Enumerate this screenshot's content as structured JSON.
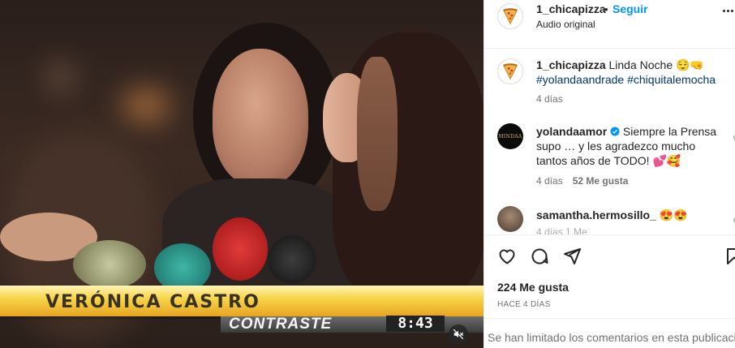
{
  "video": {
    "lower_third_name": "VERÓNICA CASTRO",
    "ticker_label": "CONTRASTE",
    "ticker_time": "8:43",
    "mute_icon": "speaker-muted-icon"
  },
  "header": {
    "username": "1_chicapizza",
    "separator": "•",
    "follow_label": "Seguir",
    "audio_label": "Audio original",
    "more_icon": "more-horizontal-icon"
  },
  "caption": {
    "username": "1_chicapizza",
    "text": "Linda Noche 😌🤜",
    "hashtags": "#yolandaandrade #chiquitalemocha",
    "time": "4 días"
  },
  "comments": [
    {
      "username": "yolandaamor",
      "verified": true,
      "avatar_text": "MINDAA",
      "line1": "Siempre la Prensa",
      "line2": "supo … y les agradezco mucho",
      "line3": "tantos años de TODO! 💕🥰",
      "time": "4 días",
      "likes": "52 Me gusta"
    },
    {
      "username": "samantha.hermosillo_",
      "text": "😍😍",
      "time_partial": "4 días  1 Me"
    }
  ],
  "actions": {
    "like_icon": "heart-icon",
    "comment_icon": "comment-icon",
    "share_icon": "share-icon",
    "save_icon": "bookmark-icon",
    "likes": "224 Me gusta",
    "date": "HACE 4 DÍAS"
  },
  "limited_text": "Se han limitado los comentarios en esta publicación.",
  "colors": {
    "link_blue": "#0095f6",
    "hashtag": "#00376b",
    "text": "#262626",
    "muted": "#737373"
  }
}
